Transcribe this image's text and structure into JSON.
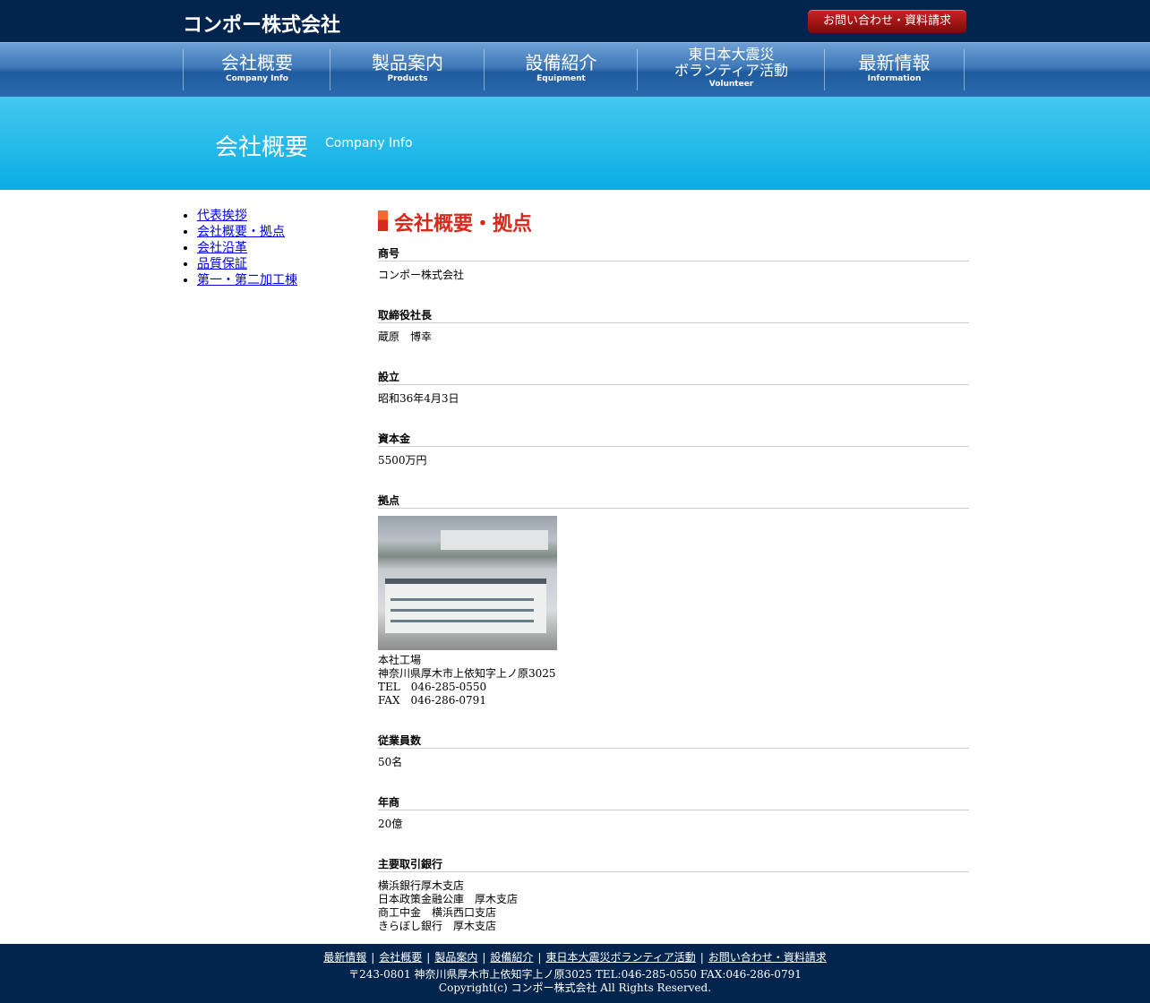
{
  "header": {
    "logo": "コンポー株式会社",
    "contact_button": "お問い合わせ・資料請求"
  },
  "nav": {
    "items": [
      {
        "jp": "会社概要",
        "en": "Company Info"
      },
      {
        "jp": "製品案内",
        "en": "Products"
      },
      {
        "jp": "設備紹介",
        "en": "Equipment"
      },
      {
        "jp_line1": "東日本大震災",
        "jp_line2": "ボランティア活動",
        "en": "Volunteer"
      },
      {
        "jp": "最新情報",
        "en": "Information"
      }
    ]
  },
  "hero": {
    "title_jp": "会社概要",
    "title_en": "Company Info"
  },
  "sidebar": {
    "links": [
      "代表挨拶",
      "会社概要・拠点",
      "会社沿革",
      "品質保証",
      "第一・第二加工棟"
    ]
  },
  "content": {
    "title": "会社概要・拠点",
    "items": [
      {
        "label": "商号",
        "value": "コンポー株式会社"
      },
      {
        "label": "取締役社長",
        "value": "蔵原　博幸"
      },
      {
        "label": "設立",
        "value": "昭和36年4月3日"
      },
      {
        "label": "資本金",
        "value": "5500万円"
      },
      {
        "label": "拠点",
        "lines": [
          "本社工場",
          "神奈川県厚木市上依知字上ノ原3025",
          "TEL　046-285-0550",
          "FAX　046-286-0791"
        ]
      },
      {
        "label": "従業員数",
        "value": "50名"
      },
      {
        "label": "年商",
        "value": "20億"
      },
      {
        "label": "主要取引銀行",
        "lines": [
          "横浜銀行厚木支店",
          "日本政策金融公庫　厚木支店",
          "商工中金　横浜西口支店",
          "きらぼし銀行　厚木支店"
        ]
      }
    ]
  },
  "footer": {
    "links": [
      "最新情報",
      "会社概要",
      "製品案内",
      "設備紹介",
      "東日本大震災ボランティア活動",
      "お問い合わせ・資料請求"
    ],
    "separator": "|",
    "address": "〒243-0801 神奈川県厚木市上依知字上ノ原3025 TEL:046-285-0550 FAX:046-286-0791",
    "copyright": "Copyright(c) コンポー株式会社 All Rights Reserved."
  }
}
